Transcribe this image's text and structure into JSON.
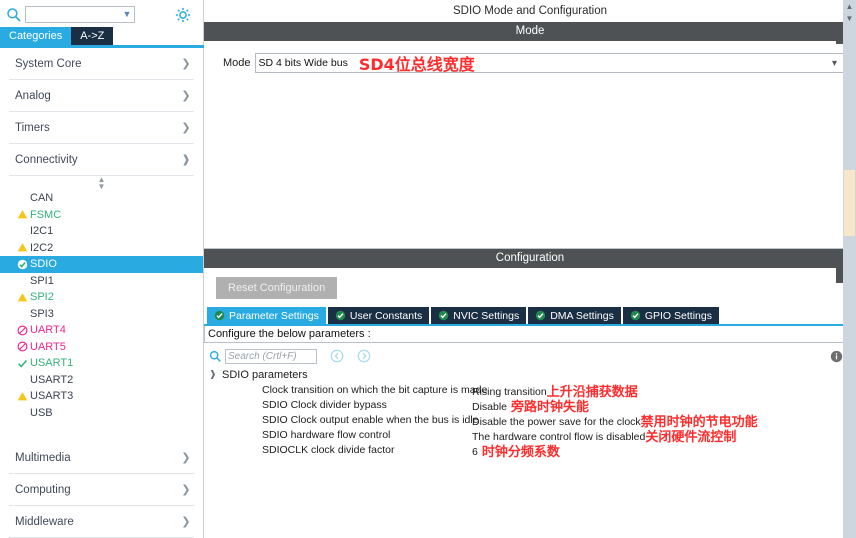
{
  "sidebar": {
    "search": {
      "value": "",
      "icon": "search-icon"
    },
    "settings_icon": "gear-icon",
    "tabs": [
      {
        "label": "Categories",
        "active": true
      },
      {
        "label": "A->Z",
        "active": false
      }
    ],
    "categories_top": [
      {
        "label": "System Core",
        "expanded": false
      },
      {
        "label": "Analog",
        "expanded": false
      },
      {
        "label": "Timers",
        "expanded": false
      },
      {
        "label": "Connectivity",
        "expanded": true
      }
    ],
    "peripherals": [
      {
        "label": "CAN",
        "status": "none",
        "color": "default"
      },
      {
        "label": "FSMC",
        "status": "warning",
        "color": "green"
      },
      {
        "label": "I2C1",
        "status": "none",
        "color": "default"
      },
      {
        "label": "I2C2",
        "status": "warning",
        "color": "default"
      },
      {
        "label": "SDIO",
        "status": "ok",
        "color": "selected",
        "selected": true
      },
      {
        "label": "SPI1",
        "status": "none",
        "color": "default"
      },
      {
        "label": "SPI2",
        "status": "warning",
        "color": "green"
      },
      {
        "label": "SPI3",
        "status": "none",
        "color": "default"
      },
      {
        "label": "UART4",
        "status": "blocked",
        "color": "pink"
      },
      {
        "label": "UART5",
        "status": "blocked",
        "color": "pink"
      },
      {
        "label": "USART1",
        "status": "check",
        "color": "green"
      },
      {
        "label": "USART2",
        "status": "none",
        "color": "default"
      },
      {
        "label": "USART3",
        "status": "warning",
        "color": "default"
      },
      {
        "label": "USB",
        "status": "none",
        "color": "default"
      }
    ],
    "categories_bottom": [
      {
        "label": "Multimedia",
        "expanded": false
      },
      {
        "label": "Computing",
        "expanded": false
      },
      {
        "label": "Middleware",
        "expanded": false
      }
    ]
  },
  "main": {
    "panel_title": "SDIO Mode and Configuration",
    "mode_section": {
      "header": "Mode",
      "label": "Mode",
      "value": "SD 4 bits Wide bus",
      "annotation": "SD4位总线宽度"
    },
    "config_section": {
      "header": "Configuration",
      "reset_label": "Reset Configuration",
      "tabs": [
        {
          "label": "Parameter Settings",
          "active": true
        },
        {
          "label": "User Constants",
          "active": false
        },
        {
          "label": "NVIC Settings",
          "active": false
        },
        {
          "label": "DMA Settings",
          "active": false
        },
        {
          "label": "GPIO Settings",
          "active": false
        }
      ],
      "note": "Configure the below parameters :",
      "search_placeholder": "Search (Crtl+F)",
      "search_value": "",
      "prev_icon": "chevron-left-circle-icon",
      "next_icon": "chevron-right-circle-icon",
      "info_icon": "info-icon",
      "tree_group": "SDIO parameters",
      "parameters": [
        {
          "name": "Clock transition on which the bit capture is made",
          "value": "Rising transition",
          "annotation": "上升沿捕获数据",
          "tight": true
        },
        {
          "name": "SDIO Clock divider bypass",
          "value": "Disable",
          "annotation": "旁路时钟失能",
          "tight": false
        },
        {
          "name": "SDIO Clock output enable when the bus is idle",
          "value": "Disable the power save for the clock",
          "annotation": "禁用时钟的节电功能",
          "tight": true
        },
        {
          "name": "SDIO hardware flow control",
          "value": "The hardware control flow is disabled",
          "annotation": "关闭硬件流控制",
          "tight": true
        },
        {
          "name": "SDIOCLK clock divide factor",
          "value": "6",
          "annotation": "时钟分频系数",
          "tight": false
        }
      ]
    }
  },
  "colors": {
    "accent": "#29abe2",
    "tab_dark": "#1b2f44",
    "header_bar": "#4e5254",
    "annotation_red": "#ff2d2d",
    "warning_yellow": "#f5c518",
    "ok_green": "#33b27b",
    "blocked_pink": "#ec268f"
  }
}
